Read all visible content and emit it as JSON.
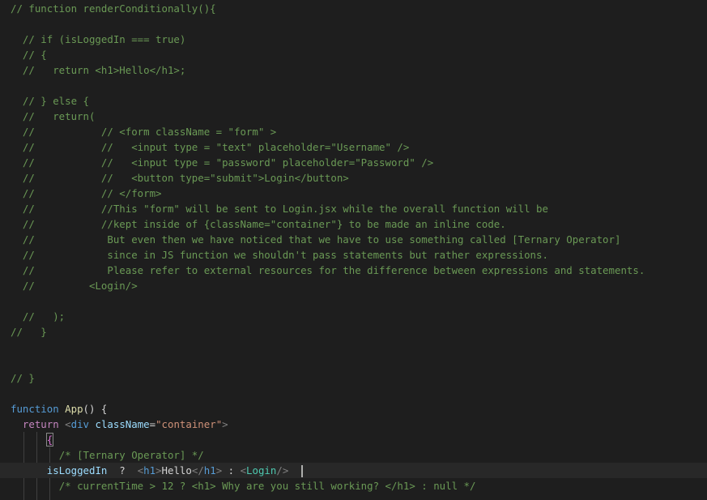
{
  "editor": {
    "lines": [
      "// function renderConditionally(){",
      "",
      "  // if (isLoggedIn === true)",
      "  // {",
      "  //   return <h1>Hello</h1>;",
      "",
      "  // } else {",
      "  //   return(",
      "  //           // <form className = \"form\" >",
      "  //           //   <input type = \"text\" placeholder=\"Username\" />",
      "  //           //   <input type = \"password\" placeholder=\"Password\" />",
      "  //           //   <button type=\"submit\">Login</button>",
      "  //           // </form>",
      "  //           //This \"form\" will be sent to Login.jsx while the overall function will be",
      "  //           //kept inside of {className=\"container\"} to be made an inline code.",
      "  //            But even then we have noticed that we have to use something called [Ternary Operator]",
      "  //            since in JS function we shouldn't pass statements but rather expressions.",
      "  //            Please refer to external resources for the difference between expressions and statements.",
      "  //         <Login/>",
      "",
      "  //   );",
      "//   }",
      "",
      "",
      "// }",
      ""
    ],
    "code_tokens": {
      "kw_function": "function",
      "fn_app": "App",
      "fn_parens": "() {",
      "kw_return": "return",
      "lt": "<",
      "gt": ">",
      "tag_div": "div",
      "attr_classname": "className",
      "eq": "=",
      "str_container": "\"container\"",
      "open_brace": "{",
      "comment_ternary": "/* [Ternary Operator] */",
      "var_isloggedin": "isLoggedIn",
      "ternary_q": "?",
      "tag_h1": "h1",
      "text_hello": "Hello",
      "close_lt": "</",
      "ternary_colon": ":",
      "comp_login": "Login",
      "selfclose": "/>",
      "comment_currenttime": "/* currentTime > 12 ? <h1> Why are you still working? </h1> : null */"
    }
  }
}
